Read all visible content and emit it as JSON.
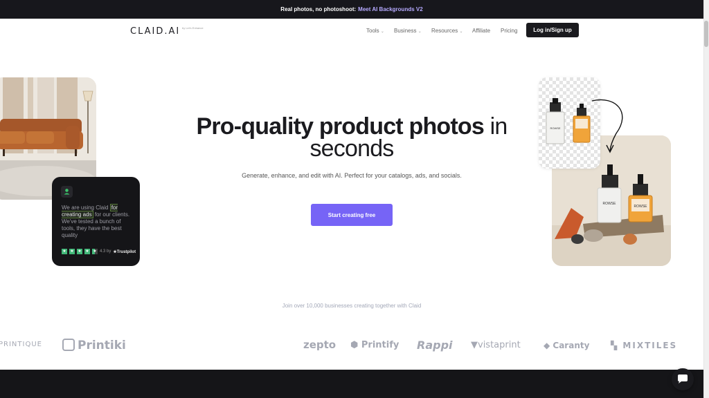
{
  "announcement": {
    "text": "Real photos, no photoshoot:",
    "link": "Meet AI Backgrounds V2"
  },
  "nav": {
    "logo": "CLAID.AI",
    "logo_sub": "by Let's Enhance",
    "items": [
      {
        "label": "Tools",
        "has_caret": true
      },
      {
        "label": "Business",
        "has_caret": true
      },
      {
        "label": "Resources",
        "has_caret": true
      },
      {
        "label": "Affiliate",
        "has_caret": false
      },
      {
        "label": "Pricing",
        "has_caret": false
      }
    ],
    "login_label": "Log in/Sign up"
  },
  "hero": {
    "title_bold": "Pro-quality product photos",
    "title_light_1": "in",
    "title_light_2": "seconds",
    "subtitle": "Generate, enhance, and edit with AI. Perfect for your catalogs, ads, and socials.",
    "cta_label": "Start creating free"
  },
  "testimonial": {
    "quote_pre": "We are using Claid",
    "quote_highlight": "for creating ads",
    "quote_post": "for our clients. We've tested a bunch of tools, they have the best quality",
    "rating": "4.3 by",
    "platform": "Trustpilot"
  },
  "product_labels": {
    "bottle_brand": "ROWSE"
  },
  "social_proof": {
    "text": "Join over 10,000 businesses creating together with Claid",
    "brands": [
      "PRINTIQUE",
      "Printiki",
      "zepto",
      "Printify",
      "Rappi",
      "vistaprint",
      "Caranty",
      "MIXTILES"
    ]
  },
  "colors": {
    "accent": "#7664f6",
    "dark": "#151518",
    "announce_link": "#b6aaff",
    "trustpilot": "#42b879"
  }
}
